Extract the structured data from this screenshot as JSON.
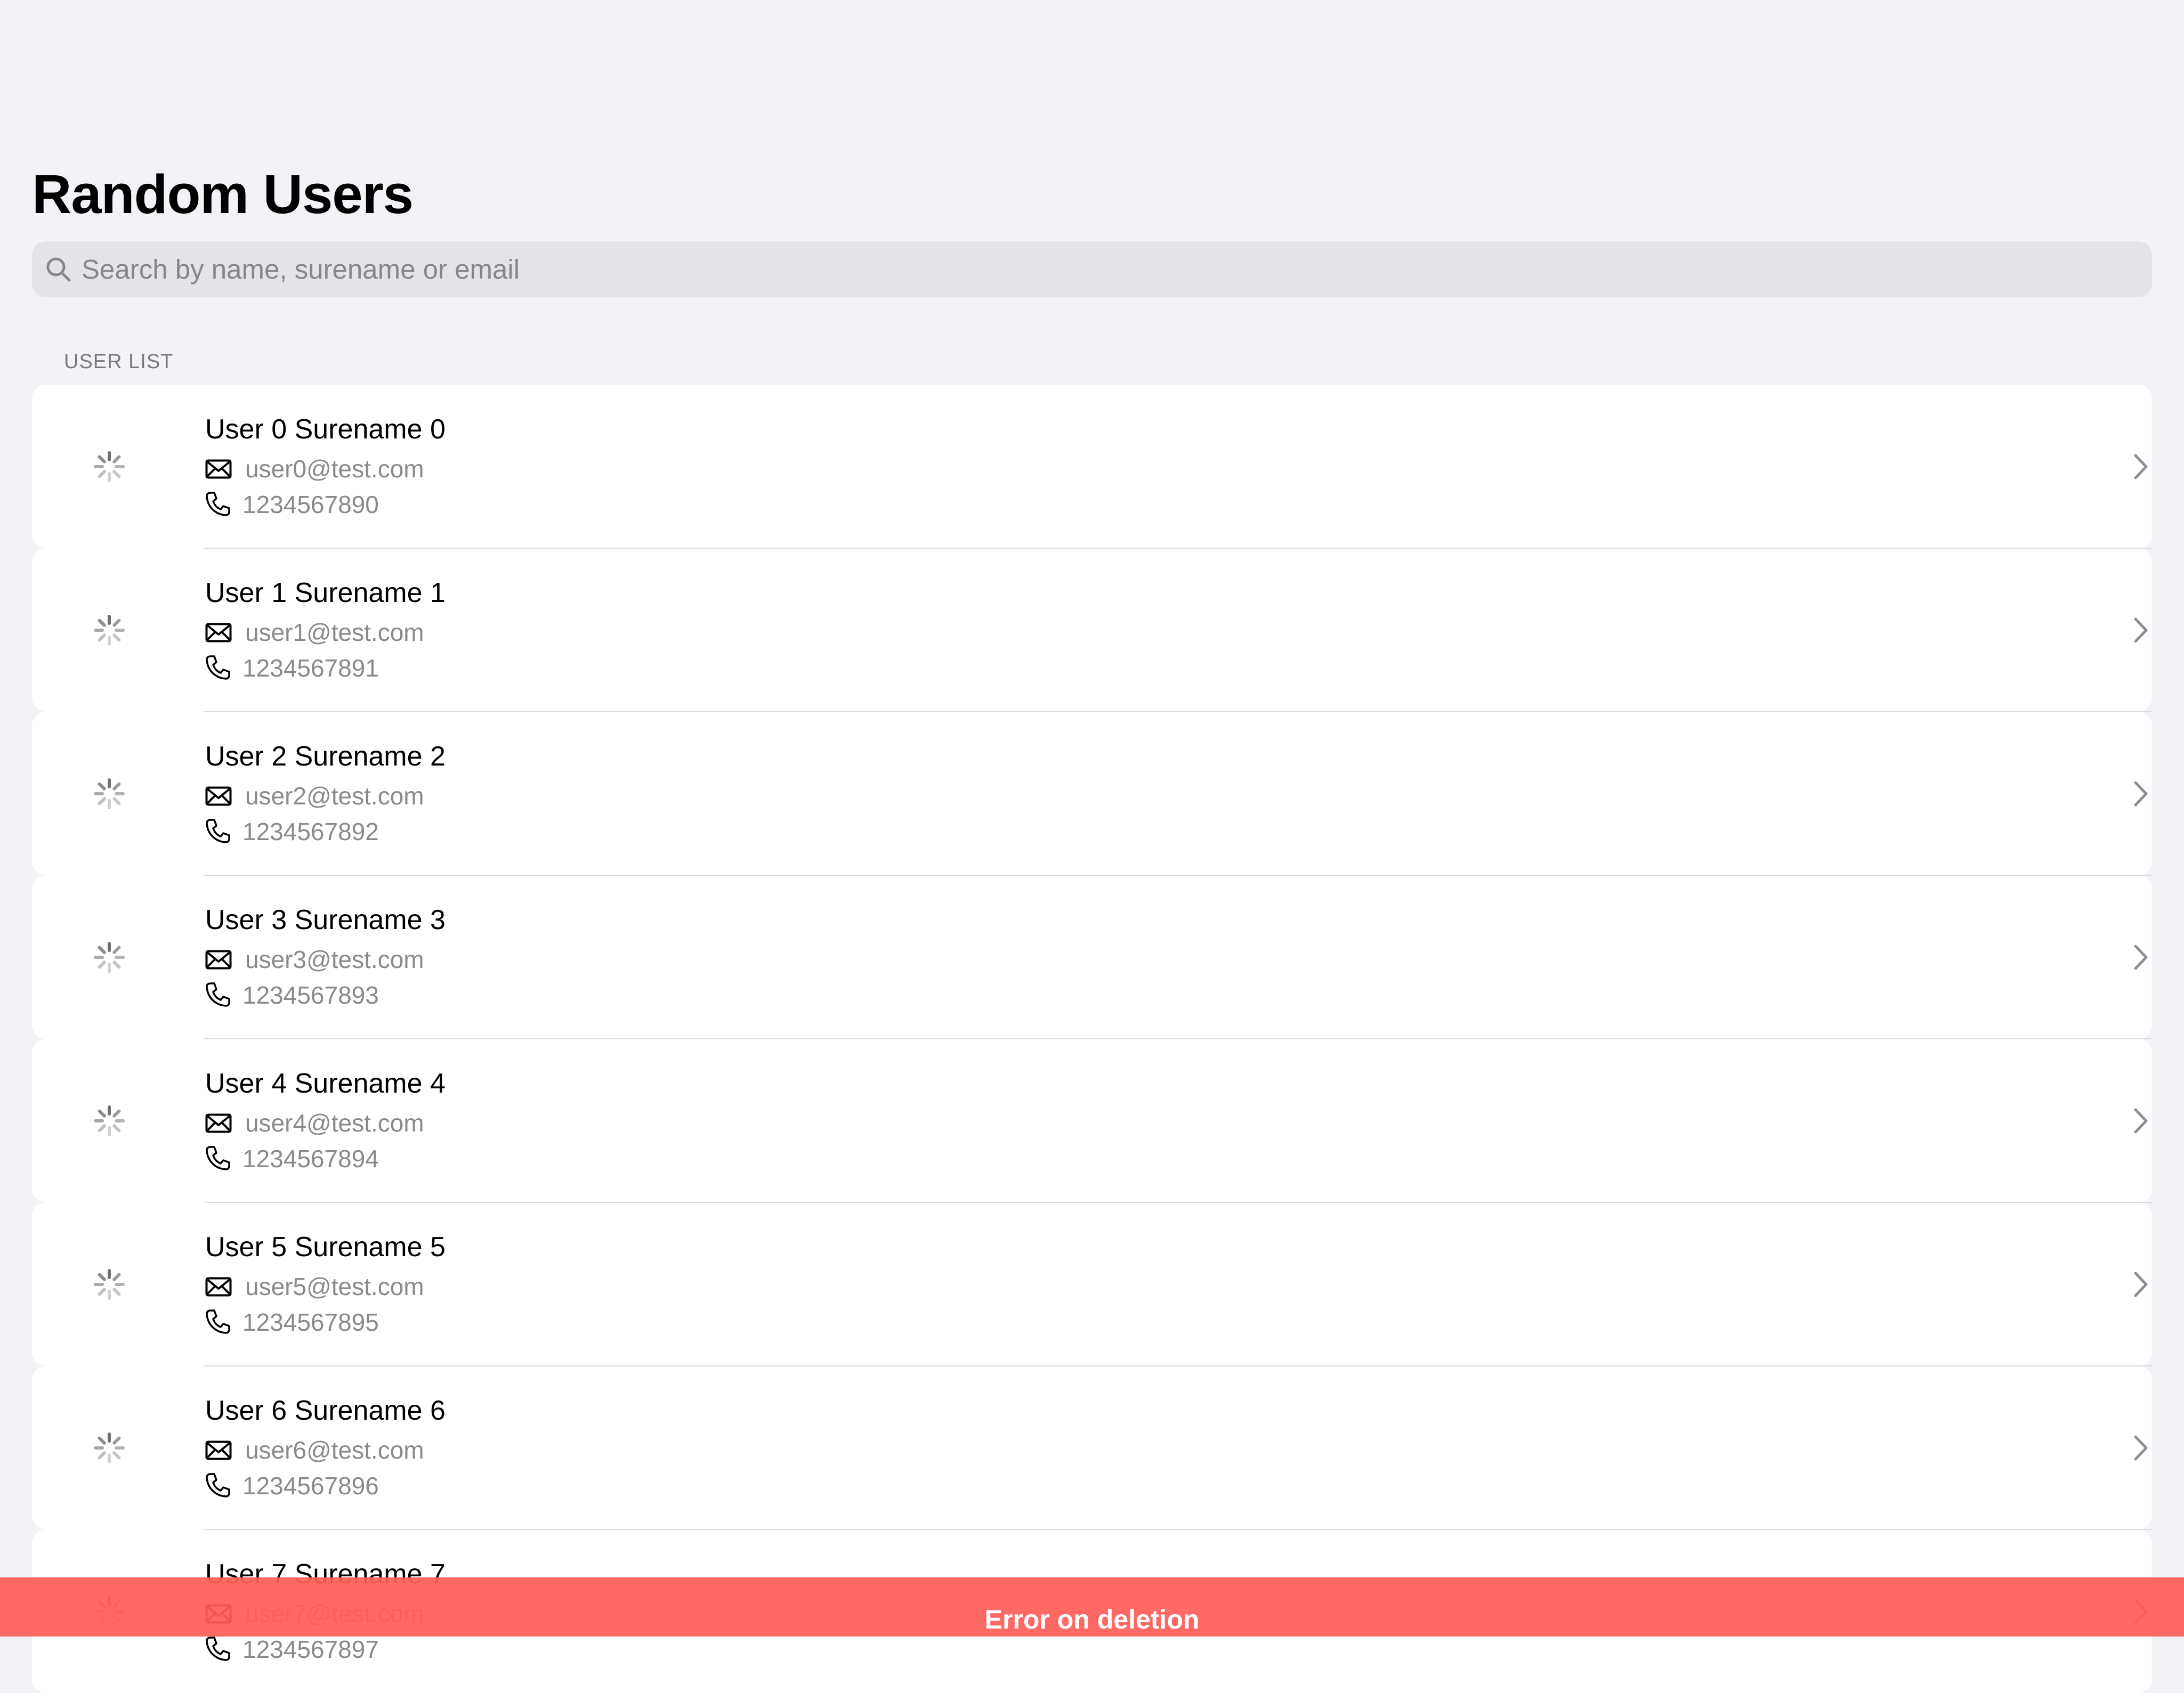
{
  "header": {
    "title": "Random Users"
  },
  "search": {
    "placeholder": "Search by name, surename or email",
    "value": "",
    "icon": "search-icon"
  },
  "section": {
    "title": "USER LIST"
  },
  "users": [
    {
      "name": "User 0 Surename 0",
      "email": "user0@test.com",
      "phone": "1234567890"
    },
    {
      "name": "User 1 Surename 1",
      "email": "user1@test.com",
      "phone": "1234567891"
    },
    {
      "name": "User 2 Surename 2",
      "email": "user2@test.com",
      "phone": "1234567892"
    },
    {
      "name": "User 3 Surename 3",
      "email": "user3@test.com",
      "phone": "1234567893"
    },
    {
      "name": "User 4 Surename 4",
      "email": "user4@test.com",
      "phone": "1234567894"
    },
    {
      "name": "User 5 Surename 5",
      "email": "user5@test.com",
      "phone": "1234567895"
    },
    {
      "name": "User 6 Surename 6",
      "email": "user6@test.com",
      "phone": "1234567896"
    },
    {
      "name": "User 7 Surename 7",
      "email": "user7@test.com",
      "phone": "1234567897"
    }
  ],
  "icons": {
    "avatar": "loading-spinner-icon",
    "email": "envelope-icon",
    "phone": "phone-icon",
    "disclosure": "chevron-right-icon"
  },
  "toast": {
    "message": "Error on deletion",
    "color": "#ff5e58"
  },
  "colors": {
    "background": "#f2f2f7",
    "card": "#ffffff",
    "secondary_text": "#8a8a8e"
  }
}
